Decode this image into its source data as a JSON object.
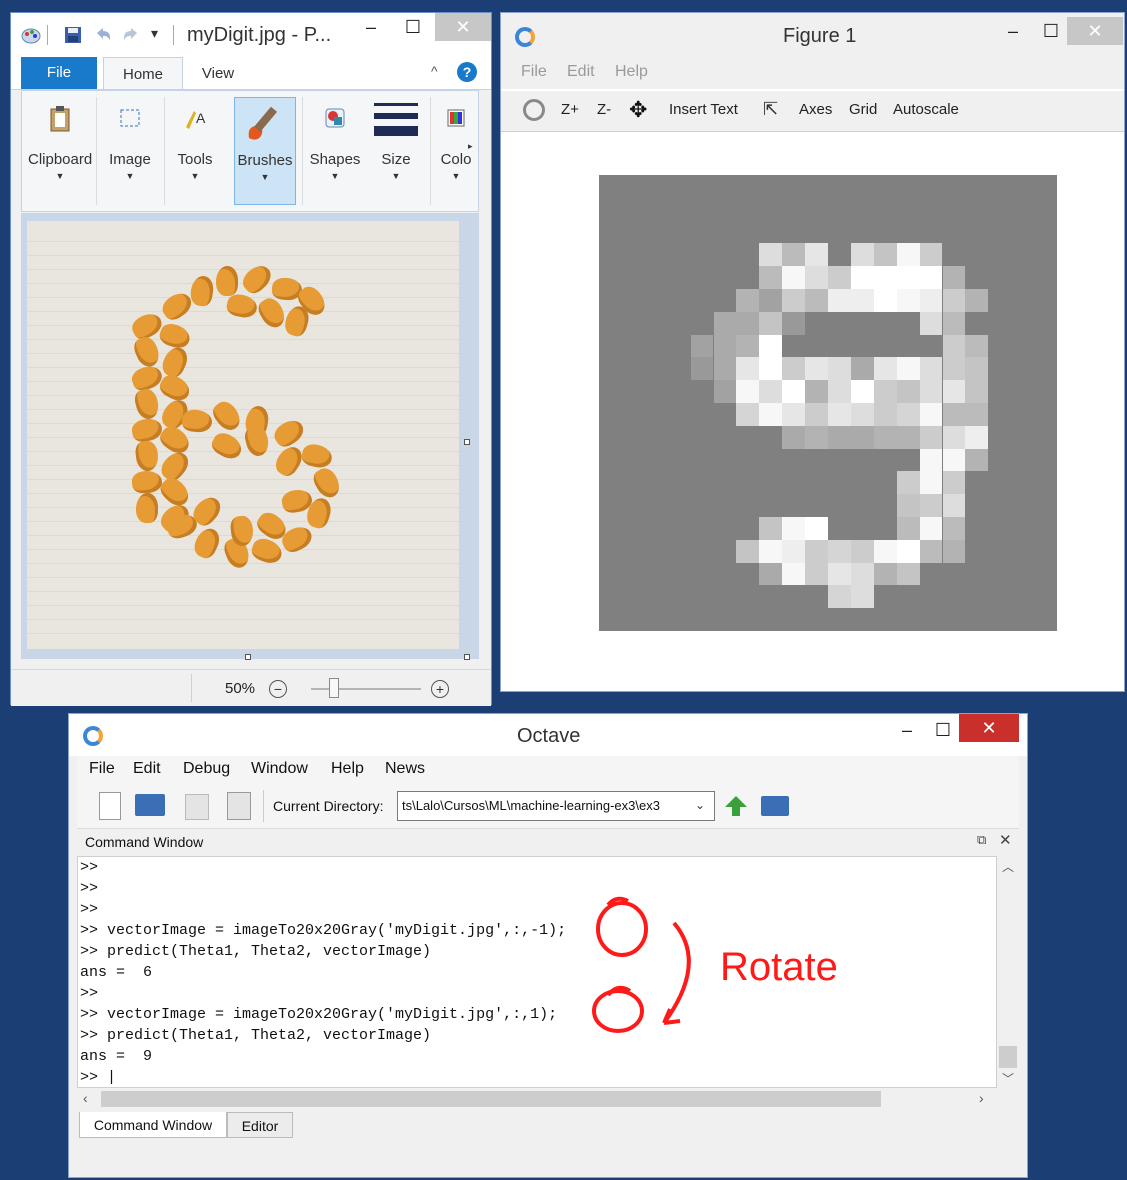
{
  "paint": {
    "title": "myDigit.jpg - P...",
    "tabs": {
      "file": "File",
      "home": "Home",
      "view": "View"
    },
    "ribbon_groups": [
      "Clipboard",
      "Image",
      "Tools",
      "Brushes",
      "Shapes",
      "Size",
      "Colo"
    ],
    "zoom": "50%",
    "help_glyph": "?"
  },
  "figure": {
    "title": "Figure 1",
    "menu": [
      "File",
      "Edit",
      "Help"
    ],
    "toolbar": [
      "Z+",
      "Z-",
      "Insert Text",
      "Axes",
      "Grid",
      "Autoscale"
    ],
    "plot_background": "#808080",
    "digit_pixels": {
      "note_cols": 20,
      "rows": [
        "00000000000000000000",
        "00000000000000000000",
        "00000000000000000000",
        "0000000b7c0b8e900000",
        "00000007eb9ffff60000",
        "0000006497ddfed96000",
        "00000558300000b70000",
        "0000456f000000097000",
        "000035cf9cb5ceb98000",
        "000004ebf6bf98bc8000",
        "000000aec9cb9ae77000",
        "000000005655669bd000",
        "00000000000000ee6000",
        "00000000000009e90000",
        "000000000000089b0000",
        "00000008ef0007e70000",
        "0000008ed9a9ef760000",
        "00000005e9cb68000000",
        "0000000000ab00000000",
        "00000000000000000000"
      ]
    }
  },
  "octave": {
    "title": "Octave",
    "menu": [
      "File",
      "Edit",
      "Debug",
      "Window",
      "Help",
      "News"
    ],
    "cd_label": "Current Directory:",
    "cd_value": "ts\\Lalo\\Cursos\\ML\\machine-learning-ex3\\ex3",
    "dock_title": "Command Window",
    "console_lines": [
      ">>",
      ">>",
      ">>",
      ">> vectorImage = imageTo20x20Gray('myDigit.jpg',:,-1);",
      ">> predict(Theta1, Theta2, vectorImage)",
      "ans =  6",
      ">>",
      ">> vectorImage = imageTo20x20Gray('myDigit.jpg',:,1);",
      ">> predict(Theta1, Theta2, vectorImage)",
      "ans =  9",
      ">> |"
    ],
    "bottom_tabs": [
      "Command Window",
      "Editor"
    ],
    "annotation": "Rotate"
  },
  "colors": {
    "desktop": "#1b3f74",
    "file_tab": "#1979ca",
    "close_red": "#c9302c",
    "annotation": "#ff1a1a",
    "cracker": "#e69b35"
  }
}
